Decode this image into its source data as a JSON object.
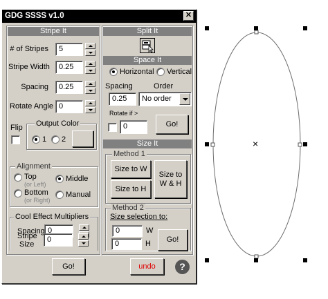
{
  "window": {
    "title": "GDG SSSS v1.0",
    "close_glyph": "✕"
  },
  "stripe_it": {
    "header": "Stripe It",
    "num_stripes_label": "# of Stripes",
    "num_stripes_value": "5",
    "stripe_width_label": "Stripe Width",
    "stripe_width_value": "0.25",
    "spacing_label": "Spacing",
    "spacing_value": "0.25",
    "rotate_label": "Rotate Angle",
    "rotate_value": "0",
    "flip_label": "Flip",
    "output_color": {
      "legend": "Output Color",
      "option1": "1",
      "option2": "2",
      "selected": "1"
    },
    "alignment": {
      "legend": "Alignment",
      "top_label": "Top",
      "top_sub": "(or Left)",
      "bottom_label": "Bottom",
      "bottom_sub": "(or Right)",
      "middle_label": "Middle",
      "manual_label": "Manual",
      "selected": "Middle"
    },
    "cool": {
      "legend": "Cool Effect Multipliers",
      "spacing_label": "Spacing",
      "spacing_value": "0",
      "stripe_size_label_1": "Stripe",
      "stripe_size_label_2": "Size",
      "stripe_size_value": "0"
    },
    "go_label": "Go!"
  },
  "split_it": {
    "header": "Split It",
    "icon": "split-icon"
  },
  "space_it": {
    "header": "Space It",
    "horizontal_label": "Horizontal",
    "vertical_label": "Vertical",
    "selected": "Horizontal",
    "spacing_label": "Spacing",
    "spacing_value": "0.25",
    "order_label": "Order",
    "order_value": "No order",
    "rotate_if_label": "Rotate if >",
    "rotate_if_value": "0",
    "go_label": "Go!"
  },
  "size_it": {
    "header": "Size It",
    "method1_legend": "Method  1",
    "size_to_w": "Size to W",
    "size_to_h": "Size to H",
    "size_to_wh_1": "Size to",
    "size_to_wh_2": "W & H",
    "method2_legend": "Method  2",
    "size_selection_label": "Size selection to:",
    "w_value": "0",
    "w_label": "W",
    "h_value": "0",
    "h_label": "H",
    "go_label": "Go!"
  },
  "footer": {
    "undo_label": "undo",
    "help_glyph": "?"
  },
  "canvas": {
    "center_marker": "×"
  },
  "colors": {
    "title_bar": "#000000",
    "panel_header": "#808080",
    "window_bg": "#d4d0c8",
    "undo_text": "#e00000"
  }
}
